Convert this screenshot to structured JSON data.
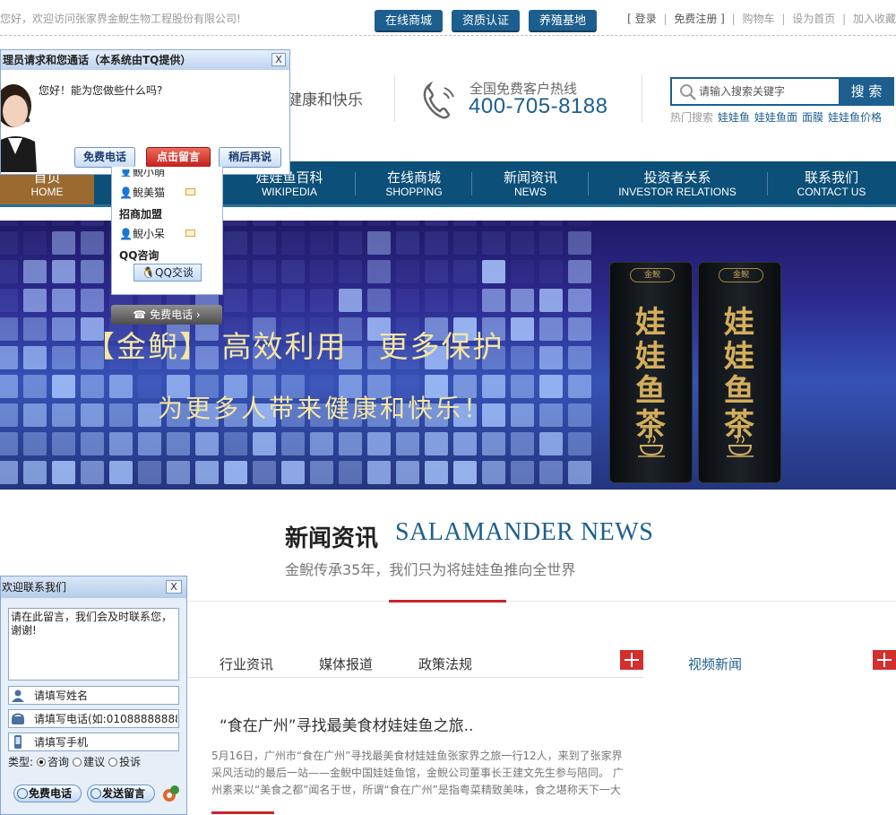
{
  "topbar": {
    "welcome": "您好，欢迎访问张家界金鲵生物工程股份有限公司!",
    "buttons": [
      "在线商城",
      "资质认证",
      "养殖基地"
    ],
    "links": {
      "bracket_open": "[",
      "login": "登录",
      "sep": "|",
      "register": "免费注册",
      "bracket_close": "]",
      "cart": "购物车",
      "homepage": "设为首页",
      "favorite": "加入收藏"
    }
  },
  "header": {
    "tagline": "健康和快乐",
    "hotline_label": "全国免费客户热线",
    "hotline_number": "400-705-8188",
    "search_placeholder": "请输入搜索关键字",
    "search_button": "搜 索",
    "hot_label": "热门搜索",
    "hot_keywords": [
      "娃娃鱼",
      "娃娃鱼面",
      "面膜",
      "娃娃鱼价格"
    ]
  },
  "nav": [
    {
      "cn": "首页",
      "en": "HOME"
    },
    {
      "cn": "娃娃鱼百科",
      "en": "WIKIPEDIA"
    },
    {
      "cn": "在线商城",
      "en": "SHOPPING"
    },
    {
      "cn": "新闻资讯",
      "en": "NEWS"
    },
    {
      "cn": "投资者关系",
      "en": "INVESTOR RELATIONS"
    },
    {
      "cn": "联系我们",
      "en": "CONTACT US"
    }
  ],
  "banner": {
    "title": "【金鲵】 高效利用　更多保护",
    "subtitle": "为更多人带来健康和快乐！",
    "product_logo": "金鲵",
    "product_name": "娃娃鱼茶"
  },
  "news": {
    "title_cn": "新闻资讯",
    "title_en": "SALAMANDER NEWS",
    "subtitle": "金鲵传承35年，我们只为将娃娃鱼推向全世界",
    "tabs": [
      "行业资讯",
      "媒体报道",
      "政策法规"
    ],
    "video_title": "视频新闻",
    "headline": "“食在广州”寻找最美食材娃娃鱼之旅..",
    "body": "5月16日，广州市“食在广州”寻找最美食材娃娃鱼张家界之旅一行12人，来到了张家界采风活动的最后一站——金鲵中国娃娃鱼馆，金鲵公司董事长王建文先生参与陪同。 广州素来以“美食之都”闻名于世，所谓“食在广州”是指粤菜精致美味，食之堪称天下一大"
  },
  "tq_popup": {
    "header": "理员请求和您通话（本系统由TQ提供）",
    "close": "X",
    "greeting": "您好！能为您做些什么吗?",
    "buttons": [
      "免费电话",
      "点击留言",
      "稍后再说"
    ]
  },
  "side_panel": {
    "items": [
      {
        "text": "鲵美猫",
        "type": "contact"
      },
      {
        "text": "招商加盟",
        "type": "heading"
      },
      {
        "text": "鲵小呆",
        "type": "contact"
      },
      {
        "text": "QQ咨询",
        "type": "heading"
      }
    ],
    "partial_item": "鲵小萌",
    "qq_button": "QQ交谈",
    "free_call": "免费电话"
  },
  "contact_form": {
    "title": "欢迎联系我们",
    "close": "X",
    "message": "请在此留言，我们会及时联系您，谢谢!",
    "name_placeholder": "请填写姓名",
    "phone_placeholder": "请填写电话(如:01088888888)",
    "mobile_placeholder": "请填写手机",
    "type_label": "类型:",
    "types": [
      "咨询",
      "建议",
      "投诉"
    ],
    "selected_type": "咨询",
    "buttons": [
      "免费电话",
      "发送留言"
    ]
  },
  "colors": {
    "brand_blue": "#1c5f8e",
    "nav_bg": "#0c4f78",
    "active_nav": "#9a6a30",
    "accent_red": "#c9262b"
  }
}
